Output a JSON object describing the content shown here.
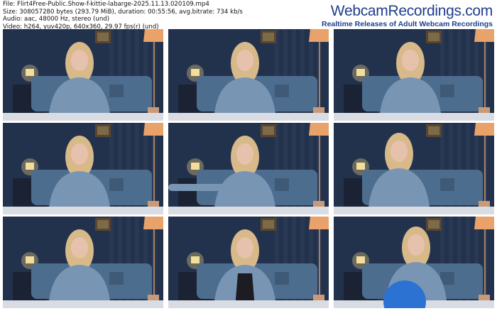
{
  "meta": {
    "line1": "File: Flirt4Free-Public.Show-f-kittie-labarge-2025.11.13.020109.mp4",
    "line2": "Size: 308057280 bytes (293.79 MiB), duration: 00:55:56, avg.bitrate: 734 kb/s",
    "line3": "Audio: aac, 48000 Hz, stereo (und)",
    "line4": "Video: h264, yuv420p, 640x360, 29.97 fps(r) (und)"
  },
  "brand": {
    "title": "WebcamRecordings.com",
    "subtitle": "Realtime Releases of Adult Webcam Recordings"
  },
  "colors": {
    "wall": "#23324c",
    "curtain": "#2c3a57",
    "sofa": "#4d6d8f",
    "lamp": "#e8a26a",
    "sweater": "#7895b4",
    "hair": "#d8b98a",
    "skin": "#e6c2ac"
  },
  "thumbnails": [
    {
      "pose": "hands-down"
    },
    {
      "pose": "talking"
    },
    {
      "pose": "hands-down"
    },
    {
      "pose": "hand-mouth"
    },
    {
      "pose": "arm-out"
    },
    {
      "pose": "lean-close"
    },
    {
      "pose": "smile"
    },
    {
      "pose": "open-top"
    },
    {
      "pose": "ball-foreground"
    }
  ]
}
